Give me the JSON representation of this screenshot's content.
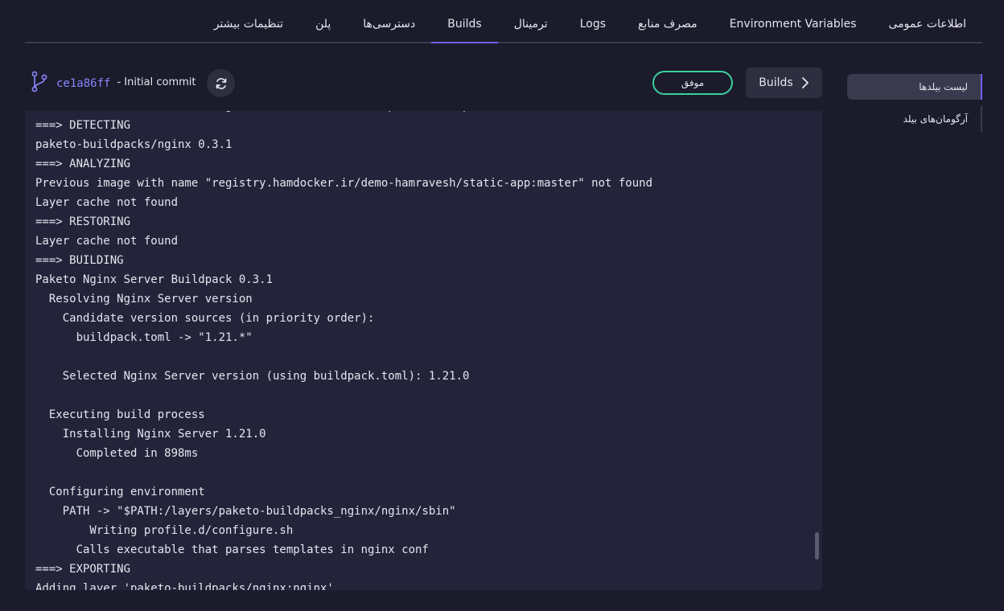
{
  "tabs": [
    {
      "label": "اطلاعات عمومی",
      "active": false
    },
    {
      "label": "Environment Variables",
      "active": false
    },
    {
      "label": "مصرف منابع",
      "active": false
    },
    {
      "label": "Logs",
      "active": false
    },
    {
      "label": "ترمینال",
      "active": false
    },
    {
      "label": "Builds",
      "active": true
    },
    {
      "label": "دسترسی‌ها",
      "active": false
    },
    {
      "label": "پلن",
      "active": false
    },
    {
      "label": "تنظیمات بیشتر",
      "active": false
    }
  ],
  "sidebar": {
    "items": [
      {
        "label": "لیست بیلدها",
        "active": true
      },
      {
        "label": "آرگومان‌های بیلد",
        "active": false
      }
    ]
  },
  "header": {
    "builds_label": "Builds",
    "status": "موفق",
    "commit_hash": "ce1a86ff",
    "commit_message": "- Initial commit",
    "icons": {
      "builds_button": "chevron-right-icon",
      "refresh": "refresh-icon",
      "branch": "git-branch-icon"
    },
    "colors": {
      "status_border": "#3ccf9f",
      "accent": "#6c63ff",
      "commit_hash": "#8a86ff"
    }
  },
  "log": {
    "lines": [
      "Status: Downloaded newer image for hub.hamdocker.ir/paketobuildpacks/builder:base",
      "===> DETECTING",
      "paketo-buildpacks/nginx 0.3.1",
      "===> ANALYZING",
      "Previous image with name \"registry.hamdocker.ir/demo-hamravesh/static-app:master\" not found",
      "Layer cache not found",
      "===> RESTORING",
      "Layer cache not found",
      "===> BUILDING",
      "Paketo Nginx Server Buildpack 0.3.1",
      "  Resolving Nginx Server version",
      "    Candidate version sources (in priority order):",
      "      buildpack.toml -> \"1.21.*\"",
      "",
      "    Selected Nginx Server version (using buildpack.toml): 1.21.0",
      "",
      "  Executing build process",
      "    Installing Nginx Server 1.21.0",
      "      Completed in 898ms",
      "",
      "  Configuring environment",
      "    PATH -> \"$PATH:/layers/paketo-buildpacks_nginx/nginx/sbin\"",
      "        Writing profile.d/configure.sh",
      "      Calls executable that parses templates in nginx conf",
      "===> EXPORTING",
      "Adding layer 'paketo-buildpacks/nginx:nginx'"
    ]
  }
}
